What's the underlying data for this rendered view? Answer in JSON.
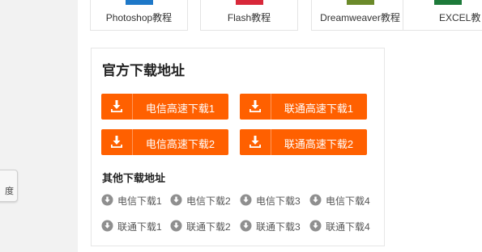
{
  "sidebar": {
    "tab_text": "度"
  },
  "tutorials": [
    {
      "label": "Photoshop教程",
      "color": "#1e78c8"
    },
    {
      "label": "Flash教程",
      "color": "#d8283a"
    },
    {
      "label": "Dreamweaver教程",
      "color": "#6b8a2a"
    },
    {
      "label": "EXCEL教",
      "color": "#1d7a3a"
    }
  ],
  "download": {
    "title": "官方下载地址",
    "buttons": [
      {
        "label": "电信高速下载1"
      },
      {
        "label": "联通高速下载1"
      },
      {
        "label": "电信高速下载2"
      },
      {
        "label": "联通高速下载2"
      }
    ],
    "other_title": "其他下载地址",
    "links": [
      "电信下载1",
      "电信下载2",
      "电信下载3",
      "电信下载4",
      "联通下载1",
      "联通下载2",
      "联通下载3",
      "联通下载4"
    ],
    "accent": "#ff6000"
  }
}
